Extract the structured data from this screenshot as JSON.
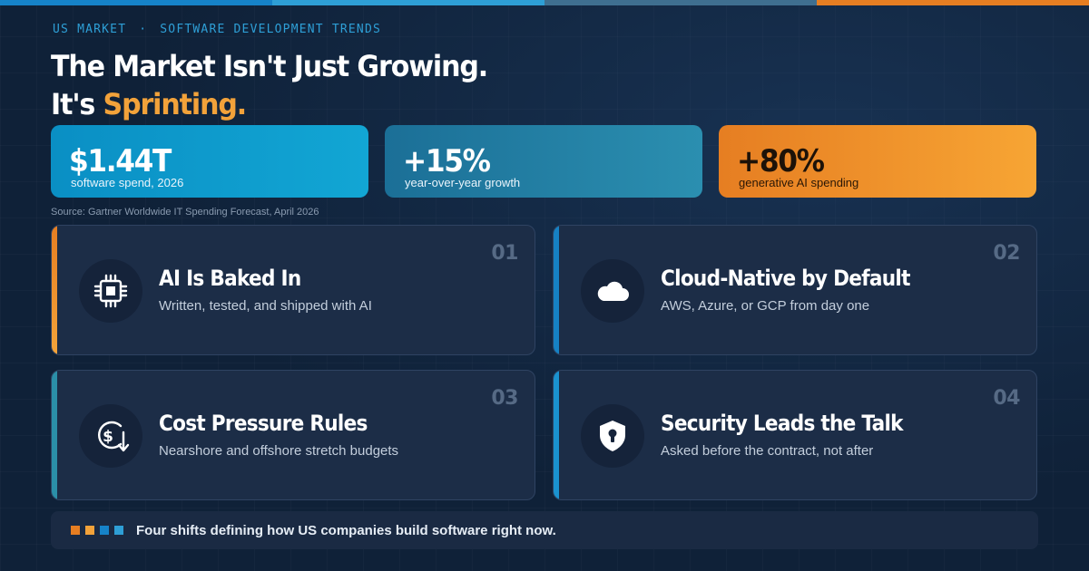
{
  "top_bar": {
    "colors": [
      "#1683c9",
      "#2e9fd6",
      "#3f6f90",
      "#e67e22"
    ]
  },
  "eyebrow": {
    "left": "US MARKET",
    "separator": "·",
    "right": "SOFTWARE DEVELOPMENT TRENDS"
  },
  "headline": {
    "line1": "The Market Isn't Just Growing.",
    "line2_prefix": "It's ",
    "line2_accent": "Sprinting."
  },
  "stats": [
    {
      "value": "$1.44T",
      "label": "software spend, 2026"
    },
    {
      "value": "+15%",
      "label": "year-over-year growth"
    },
    {
      "value": "+80%",
      "label": "generative AI spending"
    }
  ],
  "source": "Source: Gartner Worldwide IT Spending Forecast, April 2026",
  "cards": [
    {
      "number": "01",
      "title": "AI Is Baked In",
      "description": "Written, tested, and shipped with AI",
      "icon": "chip-icon"
    },
    {
      "number": "02",
      "title": "Cloud-Native by Default",
      "description": "AWS, Azure, or GCP from day one",
      "icon": "cloud-icon"
    },
    {
      "number": "03",
      "title": "Cost Pressure Rules",
      "description": "Nearshore and offshore stretch budgets",
      "icon": "dollar-down-icon"
    },
    {
      "number": "04",
      "title": "Security Leads the Talk",
      "description": "Asked before the contract, not after",
      "icon": "shield-lock-icon"
    }
  ],
  "footer": {
    "square_colors": [
      "#e67e22",
      "#f2a23a",
      "#1683c9",
      "#2e9fd6"
    ],
    "text": "Four shifts defining how US companies build software right now."
  }
}
